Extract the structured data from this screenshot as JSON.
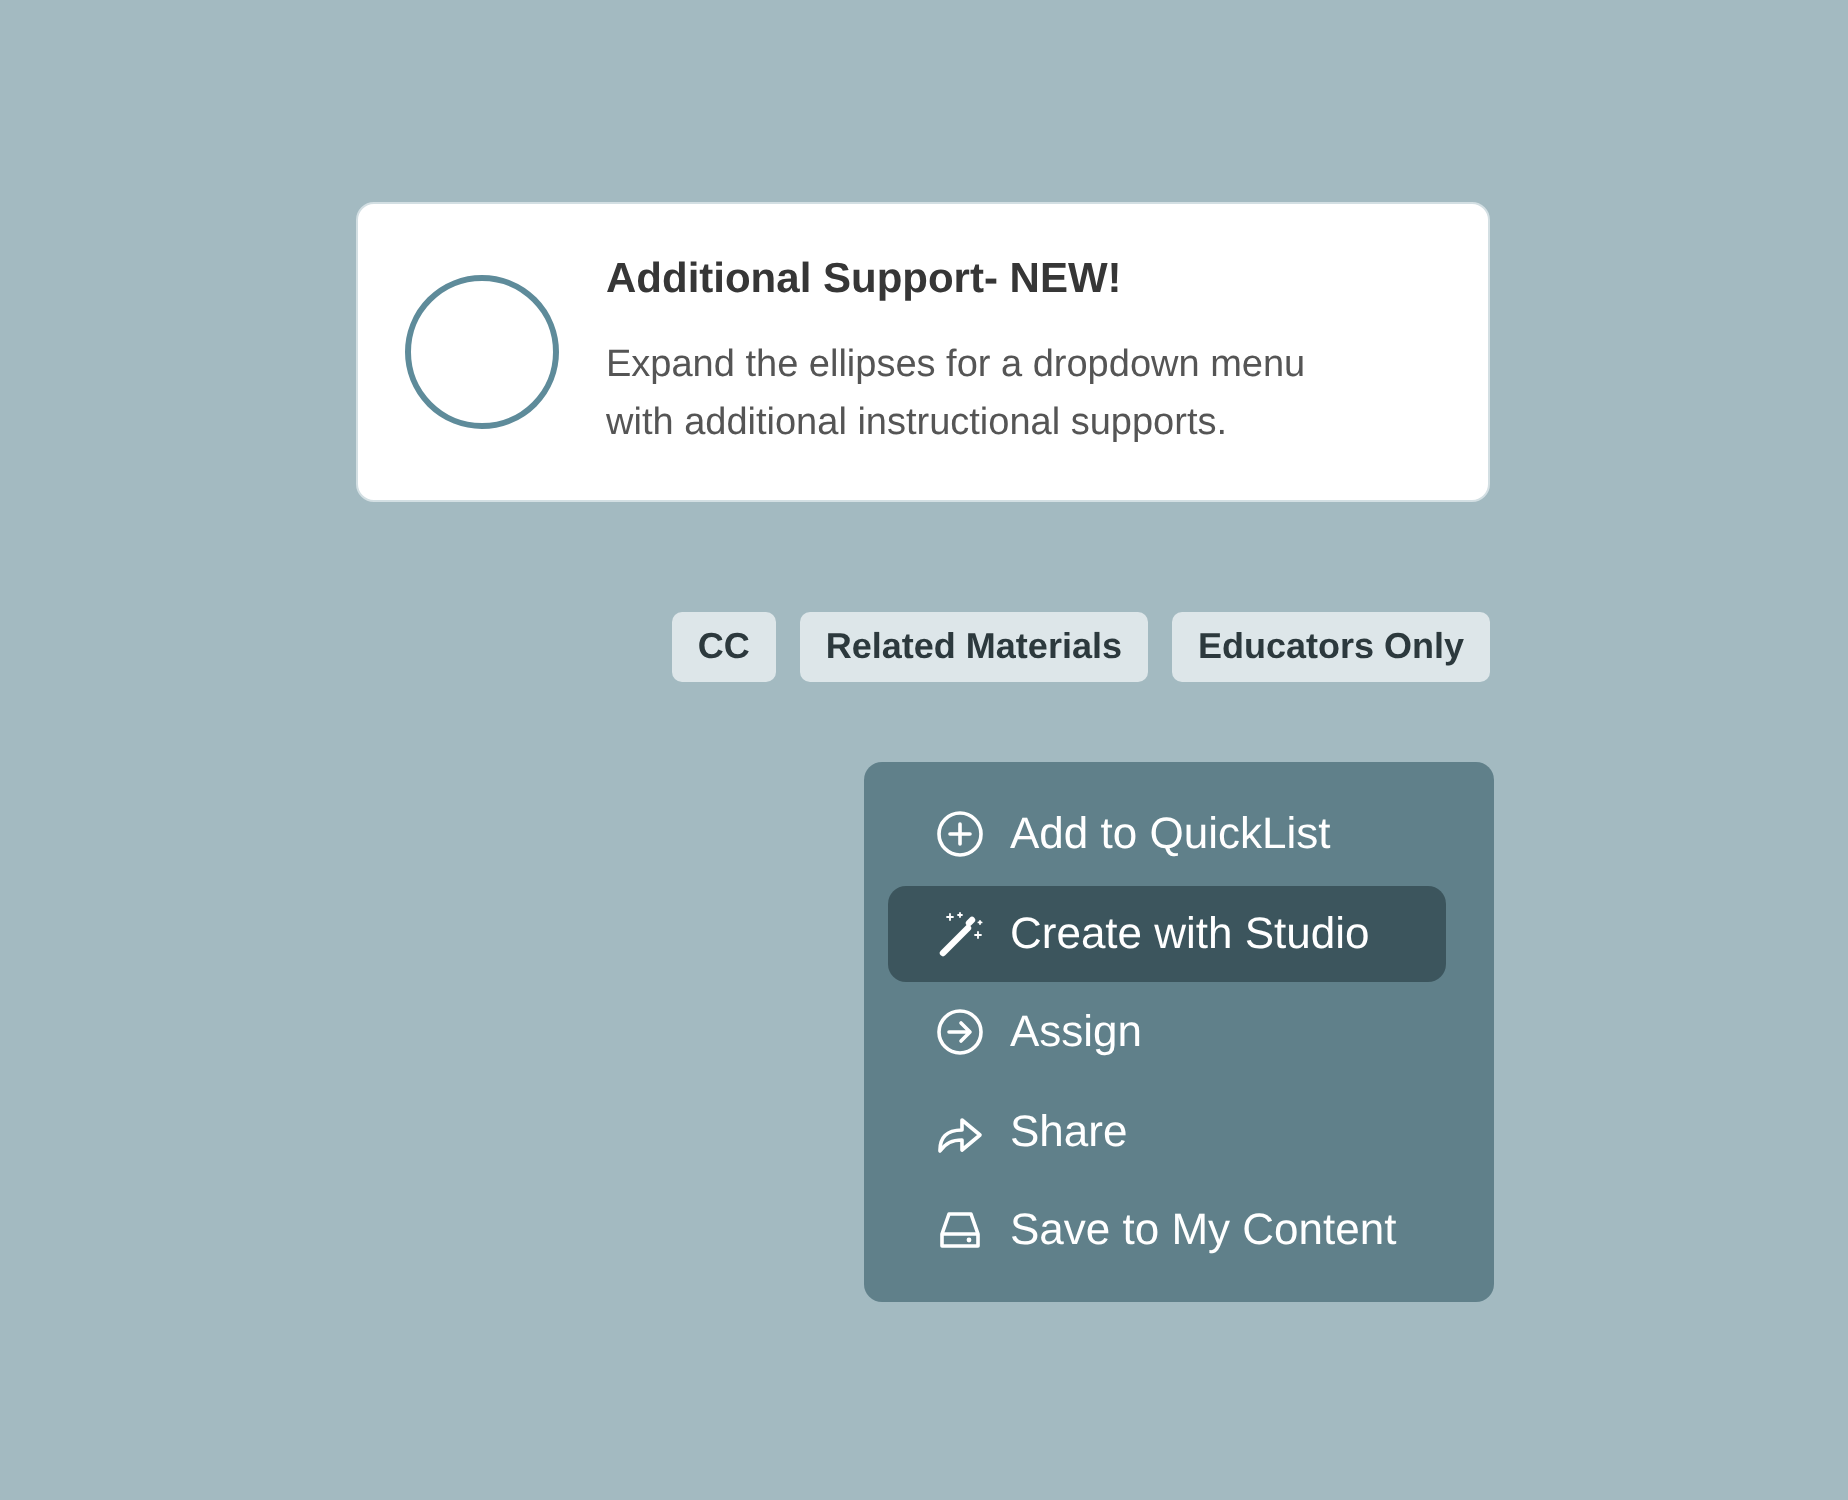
{
  "card": {
    "title": "Additional Support- NEW!",
    "text": "Expand the ellipses for a dropdown menu with additional instructional supports."
  },
  "tags": [
    "CC",
    "Related Materials",
    "Educators Only"
  ],
  "menu": {
    "items": [
      {
        "kind": "add",
        "label": "Add to QuickList",
        "selected": false
      },
      {
        "kind": "create",
        "label": "Create with Studio",
        "selected": true
      },
      {
        "kind": "assign",
        "label": "Assign",
        "selected": false
      },
      {
        "kind": "share",
        "label": "Share",
        "selected": false
      },
      {
        "kind": "save",
        "label": "Save to My Content",
        "selected": false
      }
    ]
  }
}
